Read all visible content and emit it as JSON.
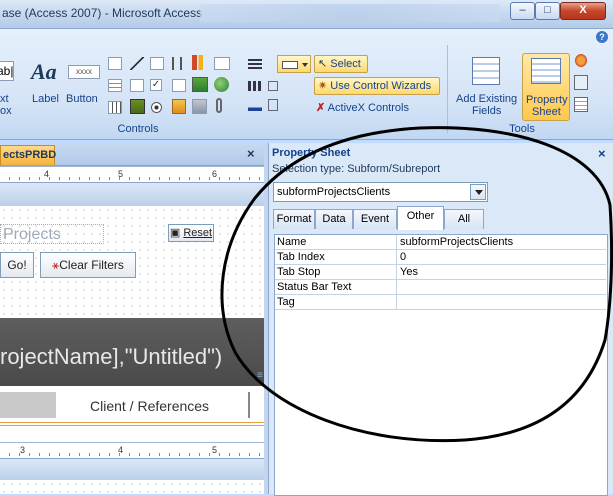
{
  "window": {
    "title": "ase (Access 2007) - Microsoft Access",
    "minimize": "–",
    "maximize": "□",
    "close": "X"
  },
  "ribbon": {
    "controls": {
      "text_box_label_1": "xt",
      "text_box_label_2": "ox",
      "label_button": "Label",
      "label_icon": "Aa",
      "button_button": "Button",
      "button_icon": "xxxx",
      "partial_icon": "ab|",
      "select": "Select",
      "use_control_wizards": "Use Control Wizards",
      "activex_controls": "ActiveX Controls",
      "group_label": "Controls"
    },
    "tools": {
      "add_existing_fields_1": "Add Existing",
      "add_existing_fields_2": "Fields",
      "property_sheet_1": "Property",
      "property_sheet_2": "Sheet",
      "group_label": "Tools"
    },
    "help_icon": "?"
  },
  "document": {
    "tab_label": "ectsPRBD",
    "close": "×",
    "ruler_top_marks": [
      "4",
      "5",
      "6"
    ],
    "ruler_bottom_marks": [
      "3",
      "4",
      "5"
    ],
    "projects_label": "Projects",
    "reset_button": "Reset",
    "go_button": "Go!",
    "clear_filters_button": "Clear Filters",
    "expression_text": "rojectName],\"Untitled\")",
    "client_references": "Client / References"
  },
  "property_sheet": {
    "title": "Property Sheet",
    "close": "×",
    "selection_type_label": "Selection type:",
    "selection_type_value": "Subform/Subreport",
    "selected_object": "subformProjectsClients",
    "tabs": [
      "Format",
      "Data",
      "Event",
      "Other",
      "All"
    ],
    "active_tab": "Other",
    "rows": [
      {
        "name": "Name",
        "value": "subformProjectsClients"
      },
      {
        "name": "Tab Index",
        "value": "0"
      },
      {
        "name": "Tab Stop",
        "value": "Yes"
      },
      {
        "name": "Status Bar Text",
        "value": ""
      },
      {
        "name": "Tag",
        "value": ""
      }
    ]
  },
  "colors": {
    "ribbon_bg": "#d3e3f6",
    "accent_orange": "#ffd86b",
    "annotation_circle": "#000000"
  }
}
